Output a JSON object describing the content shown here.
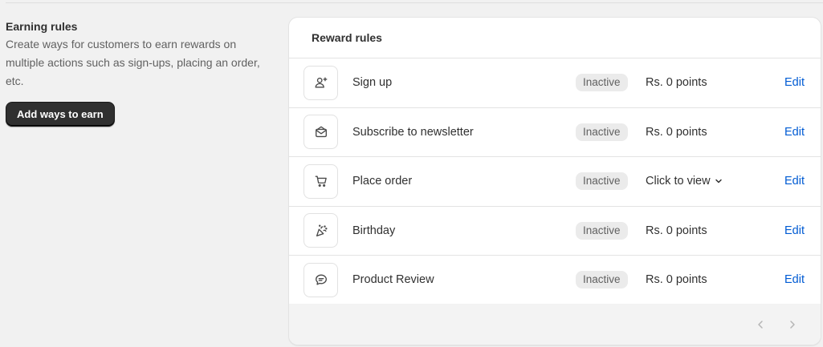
{
  "earning_section": {
    "title": "Earning rules",
    "description": "Create ways for customers to earn rewards on multiple actions such as sign-ups, placing an order, etc.",
    "add_button_label": "Add ways to earn"
  },
  "reward_card": {
    "title": "Reward rules",
    "rules": [
      {
        "name": "Sign up",
        "status": "Inactive",
        "points": "Rs. 0 points",
        "edit_label": "Edit",
        "icon": "person-add-icon"
      },
      {
        "name": "Subscribe to newsletter",
        "status": "Inactive",
        "points": "Rs. 0 points",
        "edit_label": "Edit",
        "icon": "envelope-icon"
      },
      {
        "name": "Place order",
        "status": "Inactive",
        "points": "Click to view",
        "edit_label": "Edit",
        "icon": "cart-icon"
      },
      {
        "name": "Birthday",
        "status": "Inactive",
        "points": "Rs. 0 points",
        "edit_label": "Edit",
        "icon": "party-popper-icon"
      },
      {
        "name": "Product Review",
        "status": "Inactive",
        "points": "Rs. 0 points",
        "edit_label": "Edit",
        "icon": "chat-bubble-icon"
      }
    ]
  },
  "colors": {
    "accent": "#005bd3",
    "primary_button": "#303030",
    "badge_bg": "#ebebeb",
    "page_bg": "#f1f1f1"
  }
}
